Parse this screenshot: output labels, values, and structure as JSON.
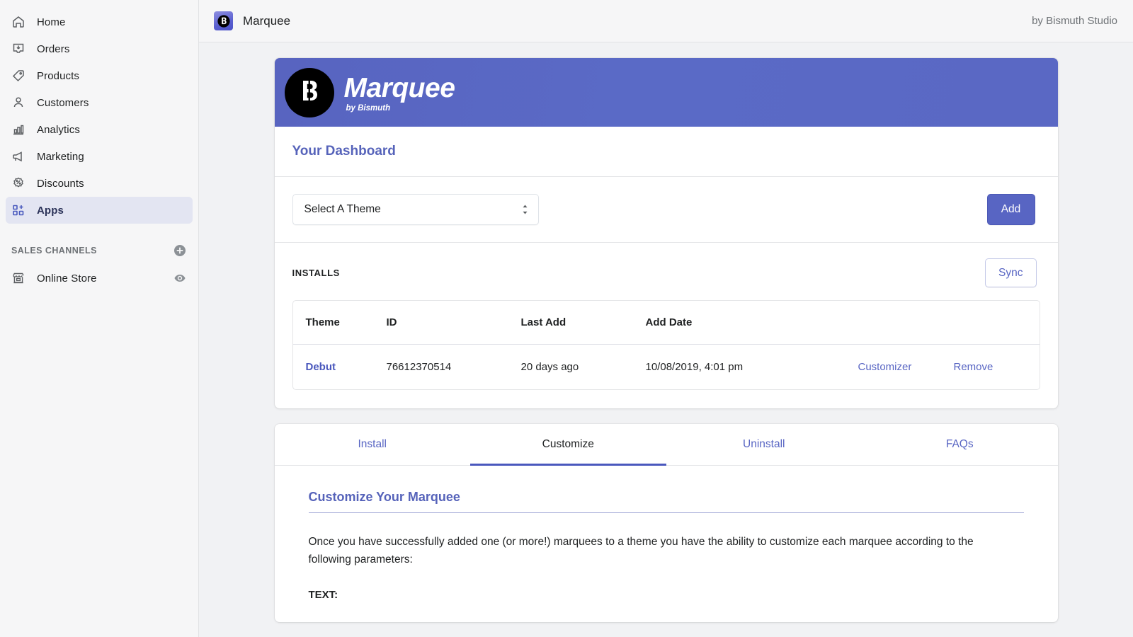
{
  "sidebar": {
    "items": [
      {
        "label": "Home",
        "icon": "home-icon",
        "active": false
      },
      {
        "label": "Orders",
        "icon": "orders-icon",
        "active": false
      },
      {
        "label": "Products",
        "icon": "tag-icon",
        "active": false
      },
      {
        "label": "Customers",
        "icon": "person-icon",
        "active": false
      },
      {
        "label": "Analytics",
        "icon": "bar-chart-icon",
        "active": false
      },
      {
        "label": "Marketing",
        "icon": "megaphone-icon",
        "active": false
      },
      {
        "label": "Discounts",
        "icon": "percent-badge-icon",
        "active": false
      },
      {
        "label": "Apps",
        "icon": "apps-grid-plus-icon",
        "active": true
      }
    ],
    "section_title": "SALES CHANNELS",
    "add_channel_icon": "plus-circle-icon",
    "channels": [
      {
        "label": "Online Store",
        "icon": "storefront-icon",
        "trailing_icon": "eye-icon"
      }
    ]
  },
  "topbar": {
    "app_icon": "bismuth-b-logo-icon",
    "title": "Marquee",
    "byline": "by Bismuth Studio"
  },
  "banner": {
    "logo_icon": "bismuth-b-circle-logo-icon",
    "title": "Marquee",
    "subtitle": "by Bismuth"
  },
  "dashboard": {
    "title": "Your Dashboard",
    "theme_select": {
      "value": "Select A Theme",
      "arrows_icon": "select-updown-arrows-icon"
    },
    "add_button": "Add",
    "installs_label": "INSTALLS",
    "sync_button": "Sync"
  },
  "installs_table": {
    "columns": [
      "Theme",
      "ID",
      "Last Add",
      "Add Date",
      "",
      ""
    ],
    "rows": [
      {
        "theme": "Debut",
        "id": "76612370514",
        "last_add": "20 days ago",
        "add_date": "10/08/2019, 4:01 pm",
        "action_customizer": "Customizer",
        "action_remove": "Remove"
      }
    ]
  },
  "tabs": [
    {
      "label": "Install",
      "active": false
    },
    {
      "label": "Customize",
      "active": true
    },
    {
      "label": "Uninstall",
      "active": false
    },
    {
      "label": "FAQs",
      "active": false
    }
  ],
  "tab_content": {
    "heading": "Customize Your Marquee",
    "paragraph": "Once you have successfully added one (or more!) marquees to a theme you have the ability to customize each marquee according to the following parameters:",
    "label_text": "TEXT:"
  },
  "colors": {
    "accent": "#5865c3",
    "accent_dark": "#4a58bd",
    "banner": "#5a68c4",
    "page_bg": "#f1f2f4",
    "sidebar_bg": "#f6f6f7",
    "active_nav_bg": "#e3e5f2"
  }
}
